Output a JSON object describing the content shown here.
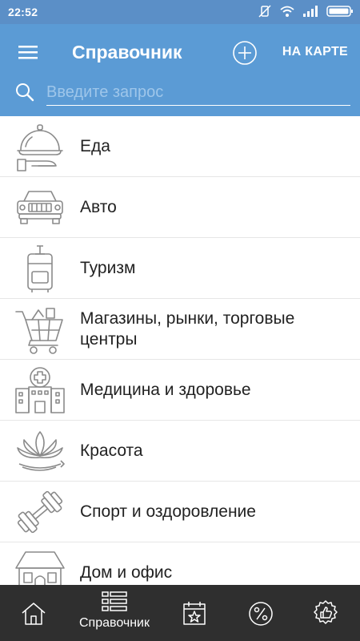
{
  "status_bar": {
    "time": "22:52"
  },
  "header": {
    "title": "Справочник",
    "map_label": "НА КАРТЕ",
    "search_placeholder": "Введите запрос"
  },
  "categories": [
    {
      "label": "Еда",
      "icon": "food-cloche-icon"
    },
    {
      "label": "Авто",
      "icon": "car-icon"
    },
    {
      "label": "Туризм",
      "icon": "suitcase-icon"
    },
    {
      "label": "Магазины, рынки, торговые центры",
      "icon": "shopping-cart-icon"
    },
    {
      "label": "Медицина и здоровье",
      "icon": "hospital-icon"
    },
    {
      "label": "Красота",
      "icon": "lotus-icon"
    },
    {
      "label": "Спорт и оздоровление",
      "icon": "dumbbell-icon"
    },
    {
      "label": "Дом и офис",
      "icon": "house-icon"
    }
  ],
  "bottom_nav": {
    "active": "directory",
    "items": [
      {
        "id": "home",
        "icon": "home-icon"
      },
      {
        "id": "directory",
        "icon": "list-icon",
        "label": "Справочник"
      },
      {
        "id": "events",
        "icon": "calendar-star-icon"
      },
      {
        "id": "discounts",
        "icon": "percent-icon"
      },
      {
        "id": "recommend",
        "icon": "thumbs-up-badge-icon"
      }
    ]
  },
  "colors": {
    "appbar": "#5b9bd5",
    "statusbar": "#5b8fc7",
    "bottom_nav": "#2f2f2f",
    "icon_gray": "#8a8a8a"
  }
}
